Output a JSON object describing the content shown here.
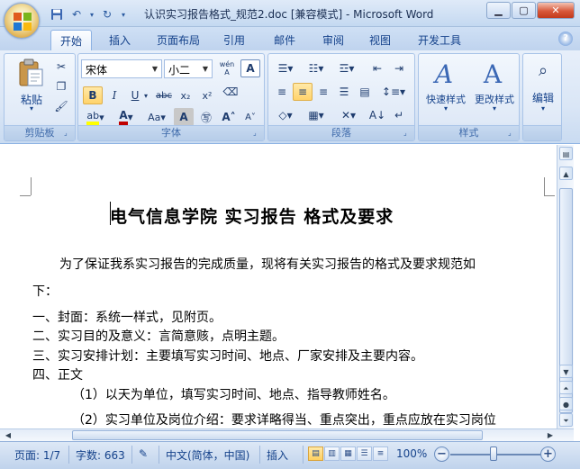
{
  "window": {
    "title": "认识实习报告格式_规范2.doc [兼容模式] - Microsoft Word",
    "quick_access": [
      "save-icon",
      "undo-icon",
      "redo-icon",
      "customize-icon"
    ]
  },
  "tabs": [
    {
      "label": "开始",
      "active": true
    },
    {
      "label": "插入"
    },
    {
      "label": "页面布局"
    },
    {
      "label": "引用"
    },
    {
      "label": "邮件"
    },
    {
      "label": "审阅"
    },
    {
      "label": "视图"
    },
    {
      "label": "开发工具"
    }
  ],
  "ribbon": {
    "clipboard": {
      "label": "剪贴板",
      "paste": "粘贴"
    },
    "font": {
      "label": "字体",
      "font_name": "宋体",
      "font_size": "小二",
      "pinyin": "wén"
    },
    "paragraph": {
      "label": "段落"
    },
    "styles": {
      "label": "样式",
      "quick_styles": "快速样式",
      "change_styles": "更改样式"
    },
    "editing": {
      "label": "编辑"
    }
  },
  "document": {
    "heading": "电气信息学院  实习报告  格式及要求",
    "lines": [
      "为了保证我系实习报告的完成质量，现将有关实习报告的格式及要求规范如",
      "下：",
      "一、封面：系统一样式，见附页。",
      "二、实习目的及意义：言简意赅，点明主题。",
      "三、实习安排计划：主要填写实习时间、地点、厂家安排及主要内容。",
      "四、正文",
      "（1）以天为单位，填写实习时间、地点、指导教师姓名。",
      "（2）实习单位及岗位介绍：要求详略得当、重点突出，重点应放在实习岗位"
    ]
  },
  "status": {
    "page": "页面: 1/7",
    "words": "字数: 663",
    "language": "中文(简体，中国)",
    "mode": "插入",
    "zoom": "100%",
    "zoom_level": 100
  },
  "colors": {
    "accent": "#15428b",
    "highlight": "#ffd36b",
    "font_color": "#c00000",
    "highlight_color": "#ffff00"
  }
}
